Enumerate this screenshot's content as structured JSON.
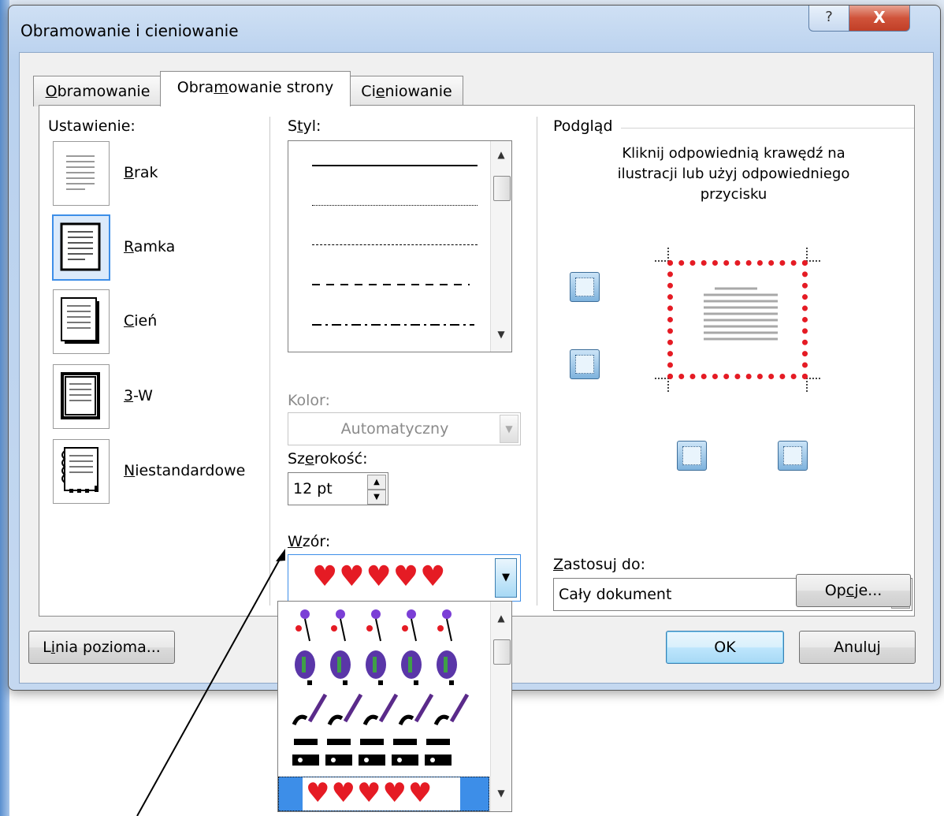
{
  "dialog": {
    "title": "Obramowanie i cieniowanie",
    "help_glyph": "?",
    "close_glyph": "X"
  },
  "tabs": [
    {
      "label_pre": "",
      "label_key": "O",
      "label_post": "bramowanie"
    },
    {
      "label_pre": "Obra",
      "label_key": "m",
      "label_post": "owanie strony"
    },
    {
      "label_pre": "Ci",
      "label_key": "e",
      "label_post": "niowanie"
    }
  ],
  "settings": {
    "heading": "Ustawienie:",
    "items": [
      {
        "key": "B",
        "rest": "rak"
      },
      {
        "key": "R",
        "rest": "amka"
      },
      {
        "key": "C",
        "rest": "ień"
      },
      {
        "key": "3",
        "rest": "-W"
      },
      {
        "key": "N",
        "rest": "iestandardowe"
      }
    ],
    "selected_index": 1
  },
  "style": {
    "label_pre": "S",
    "label_key": "t",
    "label_post": "yl:",
    "line_styles": [
      "solid",
      "dotted",
      "dashed-fine",
      "dashed",
      "dash-dot"
    ]
  },
  "color": {
    "label": "Kolor:",
    "value": "Automatyczny"
  },
  "width": {
    "label_pre": "Sz",
    "label_key": "e",
    "label_post": "rokość:",
    "value": "12 pt"
  },
  "pattern": {
    "label_pre": "",
    "label_key": "W",
    "label_post": "zór:",
    "selected": "♥♥♥♥♥",
    "options": [
      "balloons",
      "hot-air-balloons",
      "notes",
      "skates",
      "hearts"
    ]
  },
  "preview": {
    "heading": "Podgląd",
    "instruction_lines": [
      "Kliknij odpowiednią krawędź na",
      "ilustracji lub użyj odpowiedniego",
      "przycisku"
    ]
  },
  "apply_to": {
    "label_pre": "",
    "label_key": "Z",
    "label_post": "astosuj do:",
    "value": "Cały dokument"
  },
  "buttons": {
    "options_pre": "Op",
    "options_key": "c",
    "options_post": "je...",
    "horizontal_pre": "L",
    "horizontal_key": "i",
    "horizontal_post": "nia pozioma...",
    "ok": "OK",
    "cancel": "Anuluj"
  },
  "colors": {
    "accent_blue": "#3d8ee8",
    "heart_red": "#e51b24"
  }
}
